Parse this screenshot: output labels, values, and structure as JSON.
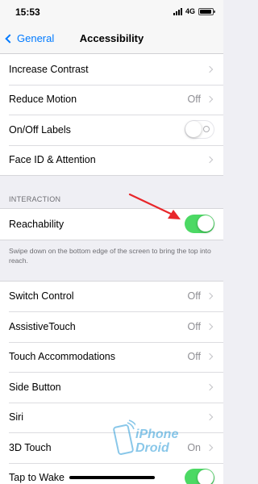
{
  "status_bar": {
    "time": "15:53",
    "network": "4G",
    "battery_level": 0.9
  },
  "nav": {
    "back_label": "General",
    "title": "Accessibility"
  },
  "group_1": [
    {
      "label": "Increase Contrast",
      "value": "",
      "accessory": "chevron"
    },
    {
      "label": "Reduce Motion",
      "value": "Off",
      "accessory": "chevron"
    },
    {
      "label": "On/Off Labels",
      "value": "",
      "accessory": "toggle-off"
    },
    {
      "label": "Face ID & Attention",
      "value": "",
      "accessory": "chevron"
    }
  ],
  "interaction": {
    "header": "INTERACTION",
    "reachability_label": "Reachability",
    "reachability_on": true,
    "footer": "Swipe down on the bottom edge of the screen to bring the top into reach."
  },
  "group_2": [
    {
      "label": "Switch Control",
      "value": "Off"
    },
    {
      "label": "AssistiveTouch",
      "value": "Off"
    },
    {
      "label": "Touch Accommodations",
      "value": "Off"
    },
    {
      "label": "Side Button",
      "value": ""
    },
    {
      "label": "Siri",
      "value": ""
    },
    {
      "label": "3D Touch",
      "value": "On"
    },
    {
      "label": "Tap to Wake",
      "value": ""
    }
  ],
  "watermark": {
    "line1": "iPhone",
    "line2": "Droid"
  },
  "colors": {
    "accent": "#007aff",
    "toggle_on": "#4cd964",
    "arrow": "#e8262a"
  }
}
